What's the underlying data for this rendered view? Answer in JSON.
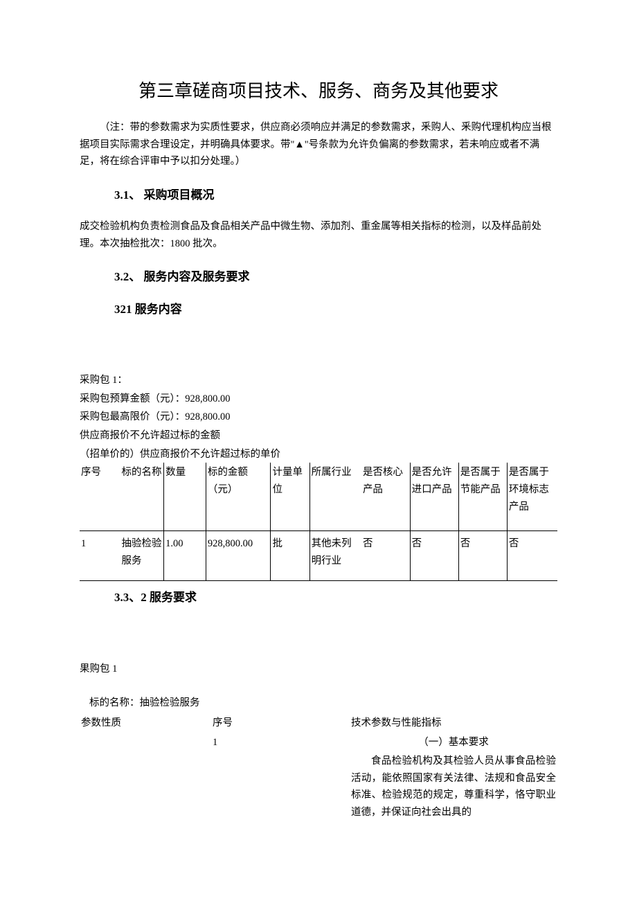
{
  "chapter_title": "第三章磋商项目技术、服务、商务及其他要求",
  "note": "（注：带的参数需求为实质性要求，供应商必须响应并满足的参数需求，釆购人、釆购代理机构应当根据项目实际需求合理设定，并明确具体要求。带\"▲\"号条款为允许负偏离的参数需求，若未响应或者不满足，将在综合评审中予以扣分处理。）",
  "section_31": "3.1、 采购项目概况",
  "overview": "成交检验机构负责检测食品及食品相关产品中微生物、添加剂、重金属等相关指标的检测，以及样品前处理。本次抽检批次：1800 批次。",
  "section_32": "3.2、 服务内容及服务要求",
  "section_321": "321 服务内容",
  "pkg": {
    "title": "采购包 1：",
    "budget": "采购包预算金额（元）：928,800.00",
    "ceiling": "采购包最高限价（元）：928,800.00",
    "rule1": "供应商报价不允许超过标的金额",
    "rule2": "（招单价的）供应商报价不允许超过标的单价"
  },
  "t1_headers": {
    "seq": "序号",
    "name": "标的名称",
    "qty": "数量",
    "amt": "标的金额（元）",
    "unit": "计量单位",
    "ind": "所属行业",
    "core": "是否核心产品",
    "imp": "是否允许进口产品",
    "es": "是否属于节能产品",
    "env": "是否属于环境标志产品"
  },
  "t1_rows": [
    {
      "seq": "1",
      "name": "抽验检验服务",
      "qty": "1.00",
      "amt": "928,800.00",
      "unit": "批",
      "ind": "其他未列明行业",
      "core": "否",
      "imp": "否",
      "es": "否",
      "env": "否"
    }
  ],
  "section_332": "3.3、2 服务要求",
  "req_pkg": "果购包 1",
  "req_name": "标的名称：抽验检验服务",
  "t2_headers": {
    "a": "参数性质",
    "b": "序号",
    "c": "技术参数与性能指标"
  },
  "t2_rows": [
    {
      "a": "",
      "b": "1",
      "spec_title": "（一）基本要求",
      "spec_body": "食品检验机构及其检验人员从事食品检验活动，能依照国家有关法律、法规和食品安全标准、检验规范的规定，尊重科学，恪守职业道德，并保证向社会出具的"
    }
  ]
}
